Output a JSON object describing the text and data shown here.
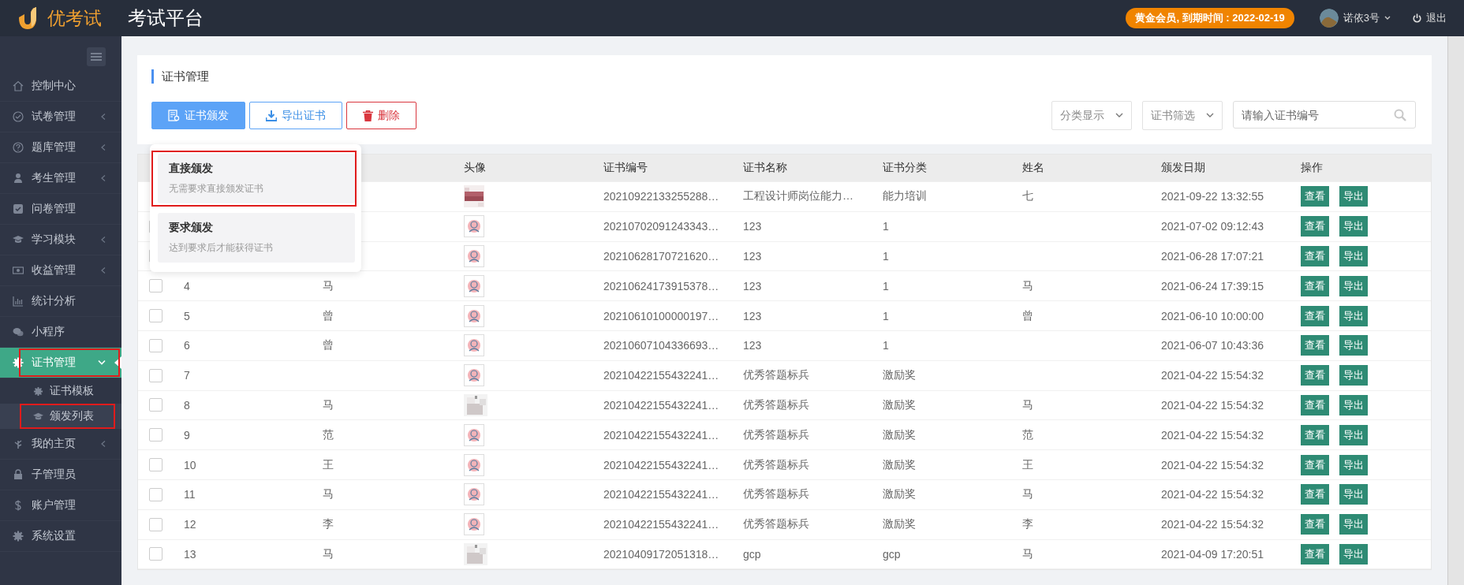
{
  "header": {
    "logo_text": "优考试",
    "title": "考试平台",
    "membership_badge": "黄金会员, 到期时间 : 2022-02-19",
    "user_name": "诺依3号",
    "logout": "退出"
  },
  "sidebar": {
    "items": [
      {
        "label": "控制中心",
        "has_arrow": false,
        "selected": false
      },
      {
        "label": "试卷管理",
        "has_arrow": true,
        "selected": false
      },
      {
        "label": "题库管理",
        "has_arrow": true,
        "selected": false
      },
      {
        "label": "考生管理",
        "has_arrow": true,
        "selected": false
      },
      {
        "label": "问卷管理",
        "has_arrow": false,
        "selected": false
      },
      {
        "label": "学习模块",
        "has_arrow": true,
        "selected": false
      },
      {
        "label": "收益管理",
        "has_arrow": true,
        "selected": false
      },
      {
        "label": "统计分析",
        "has_arrow": false,
        "selected": false
      },
      {
        "label": "小程序",
        "has_arrow": false,
        "selected": false
      },
      {
        "label": "证书管理",
        "has_arrow": true,
        "selected": true,
        "expanded": true,
        "annotated": true,
        "children": [
          {
            "label": "证书模板",
            "selected": false
          },
          {
            "label": "颁发列表",
            "selected": true,
            "annotated": true
          }
        ]
      },
      {
        "label": "我的主页",
        "has_arrow": true,
        "selected": false
      },
      {
        "label": "子管理员",
        "has_arrow": false,
        "selected": false
      },
      {
        "label": "账户管理",
        "has_arrow": false,
        "selected": false
      },
      {
        "label": "系统设置",
        "has_arrow": false,
        "selected": false
      }
    ]
  },
  "page_title": "证书管理",
  "toolbar": {
    "buttons": [
      {
        "label": "证书颁发",
        "kind": "primary"
      },
      {
        "label": "导出证书",
        "kind": "outline"
      },
      {
        "label": "删除",
        "kind": "danger"
      }
    ],
    "selects": [
      "分类显示",
      "证书筛选"
    ],
    "search": {
      "placeholder": "请输入证书编号"
    }
  },
  "issue_menu": {
    "items": [
      {
        "title": "直接颁发",
        "description": "无需要求直接颁发证书",
        "annotated": true
      },
      {
        "title": "要求颁发",
        "description": "达到要求后才能获得证书"
      }
    ]
  },
  "table": {
    "columns": [
      "头像",
      "证书编号",
      "证书名称",
      "证书分类",
      "姓名",
      "颁发日期",
      "操作"
    ],
    "rows": [
      {
        "number": "20210922133255288…",
        "cert_name": "工程设计师岗位能力…",
        "category": "能力培训",
        "person": "七",
        "date": "2021-09-22 13:32:55",
        "actions": [
          "查看",
          "导出"
        ]
      },
      {
        "checked": false,
        "kind": "icon",
        "number": "20210702091243343…",
        "cert_name": "123",
        "category": "1",
        "date": "2021-07-02 09:12:43",
        "actions": [
          "查看",
          "导出"
        ]
      },
      {
        "checked": false,
        "kind": "icon",
        "number": "20210628170721620…",
        "cert_name": "123",
        "category": "1",
        "date": "2021-06-28 17:07:21",
        "actions": [
          "查看",
          "导出"
        ]
      },
      {
        "checked": false,
        "no": "4",
        "name": "马",
        "kind": "icon",
        "number": "20210624173915378…",
        "cert_name": "123",
        "category": "1",
        "person": "马",
        "date": "2021-06-24 17:39:15",
        "actions": [
          "查看",
          "导出"
        ]
      },
      {
        "checked": false,
        "no": "5",
        "name": "曾",
        "kind": "icon",
        "number": "20210610100000197…",
        "cert_name": "123",
        "category": "1",
        "person": "曾",
        "date": "2021-06-10 10:00:00",
        "actions": [
          "查看",
          "导出"
        ]
      },
      {
        "checked": false,
        "no": "6",
        "name": "曾",
        "kind": "icon",
        "number": "20210607104336693…",
        "cert_name": "123",
        "category": "1",
        "date": "2021-06-07 10:43:36",
        "actions": [
          "查看",
          "导出"
        ]
      },
      {
        "checked": false,
        "no": "7",
        "kind": "icon",
        "number": "20210422155432241…",
        "cert_name": "优秀答题标兵",
        "category": "激励奖",
        "date": "2021-04-22 15:54:32",
        "actions": [
          "查看",
          "导出"
        ]
      },
      {
        "checked": false,
        "no": "8",
        "name": "马",
        "kind": "blur",
        "number": "20210422155432241…",
        "cert_name": "优秀答题标兵",
        "category": "激励奖",
        "person": "马",
        "date": "2021-04-22 15:54:32",
        "actions": [
          "查看",
          "导出"
        ]
      },
      {
        "checked": false,
        "no": "9",
        "name": "范",
        "kind": "icon",
        "number": "20210422155432241…",
        "cert_name": "优秀答题标兵",
        "category": "激励奖",
        "person": "范",
        "date": "2021-04-22 15:54:32",
        "actions": [
          "查看",
          "导出"
        ]
      },
      {
        "checked": false,
        "no": "10",
        "name": "王",
        "kind": "icon",
        "number": "20210422155432241…",
        "cert_name": "优秀答题标兵",
        "category": "激励奖",
        "person": "王",
        "date": "2021-04-22 15:54:32",
        "actions": [
          "查看",
          "导出"
        ]
      },
      {
        "checked": false,
        "no": "11",
        "name": "马",
        "kind": "icon",
        "number": "20210422155432241…",
        "cert_name": "优秀答题标兵",
        "category": "激励奖",
        "person": "马",
        "date": "2021-04-22 15:54:32",
        "actions": [
          "查看",
          "导出"
        ]
      },
      {
        "checked": false,
        "no": "12",
        "name": "李",
        "kind": "icon",
        "number": "20210422155432241…",
        "cert_name": "优秀答题标兵",
        "category": "激励奖",
        "person": "李",
        "date": "2021-04-22 15:54:32",
        "actions": [
          "查看",
          "导出"
        ]
      },
      {
        "checked": false,
        "no": "13",
        "name": "马",
        "kind": "blur",
        "number": "20210409172051318…",
        "cert_name": "gcp",
        "category": "gcp",
        "person": "马",
        "date": "2021-04-09 17:20:51",
        "actions": [
          "查看",
          "导出"
        ]
      }
    ]
  }
}
